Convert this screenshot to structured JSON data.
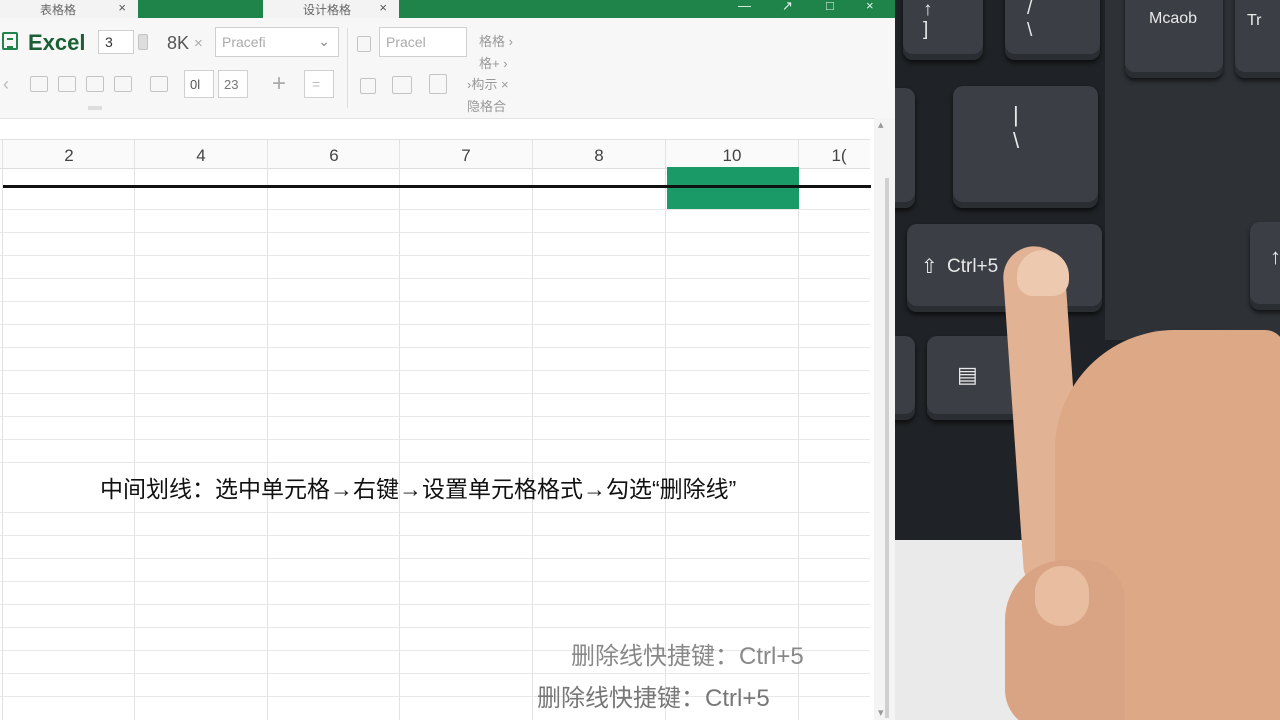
{
  "excel": {
    "tabs": [
      {
        "label": "表格格",
        "close": "×"
      },
      {
        "label": "设计格格",
        "close": "×"
      }
    ],
    "window_controls": [
      "—",
      "↗",
      "□",
      "×"
    ],
    "app_name": "Excel",
    "ribbon": {
      "num_value": "3",
      "size_text": "8K",
      "size_close": "×",
      "font_dropdown": "Pracefi",
      "font_box": "Pracel",
      "side_labels": [
        "格格 ›",
        "格+ ›",
        "›构示 ×",
        "隐格合"
      ],
      "btn_labels": [
        "0l",
        "23"
      ]
    },
    "columns": [
      "2",
      "4",
      "6",
      "7",
      "8",
      "10",
      "1("
    ],
    "scroll_arrow_left": "‹",
    "scroll_arrow_up": "▴",
    "scroll_arrow_down": "▾",
    "caption": "中间划线：选中单元格→右键→设置单元格格式→勾选“删除线”",
    "hint_primary": "删除线快捷键：Ctrl+5",
    "hint_secondary": "删除线快捷键：Ctrl+5",
    "colors": {
      "brand_green": "#1e8449",
      "selection_green": "#1a9a66"
    }
  },
  "keyboard": {
    "keys": [
      {
        "name": "bracket-key",
        "label": "↑\n]"
      },
      {
        "name": "backslash-key-top",
        "label": "/\n\\"
      },
      {
        "name": "meob-key",
        "label": "Mcaob"
      },
      {
        "name": "tr-key",
        "label": "Tr"
      },
      {
        "name": "pipe-key",
        "label": "|\n\\"
      },
      {
        "name": "ctrl5-key",
        "label": "Ctrl+5"
      },
      {
        "name": "menu-key",
        "label": "▤"
      },
      {
        "name": "left-arrow-key",
        "label": "←"
      },
      {
        "name": "up-arrow-key",
        "label": "↑"
      }
    ]
  }
}
